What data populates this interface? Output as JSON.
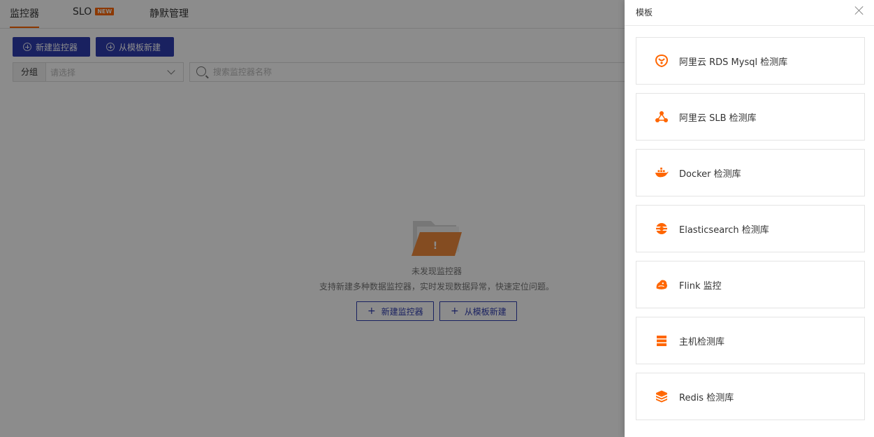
{
  "tabs": [
    {
      "label": "监控器"
    },
    {
      "label": "SLO",
      "badge": "NEW"
    },
    {
      "label": "静默管理"
    }
  ],
  "toolbar": {
    "create_label": "新建监控器",
    "template_label": "从模板新建"
  },
  "filter": {
    "group_label": "分组",
    "group_placeholder": "请选择",
    "search_placeholder": "搜索监控器名称"
  },
  "empty": {
    "title": "未发现监控器",
    "description": "支持新建多种数据监控器，实时发现数据异常，快速定位问题。",
    "create_label": "新建监控器",
    "template_label": "从模板新建"
  },
  "drawer": {
    "title": "模板",
    "templates": [
      {
        "label": "阿里云 RDS Mysql 检测库",
        "icon": "rds-icon"
      },
      {
        "label": "阿里云 SLB 检测库",
        "icon": "slb-icon"
      },
      {
        "label": "Docker 检测库",
        "icon": "docker-icon"
      },
      {
        "label": "Elasticsearch 检测库",
        "icon": "elasticsearch-icon"
      },
      {
        "label": "Flink 监控",
        "icon": "flink-icon"
      },
      {
        "label": "主机检测库",
        "icon": "host-icon"
      },
      {
        "label": "Redis 检测库",
        "icon": "redis-icon"
      }
    ]
  },
  "colors": {
    "primary": "#2f3cb0",
    "accent": "#ff6600",
    "overlay": "rgba(0,0,0,0.45)"
  }
}
